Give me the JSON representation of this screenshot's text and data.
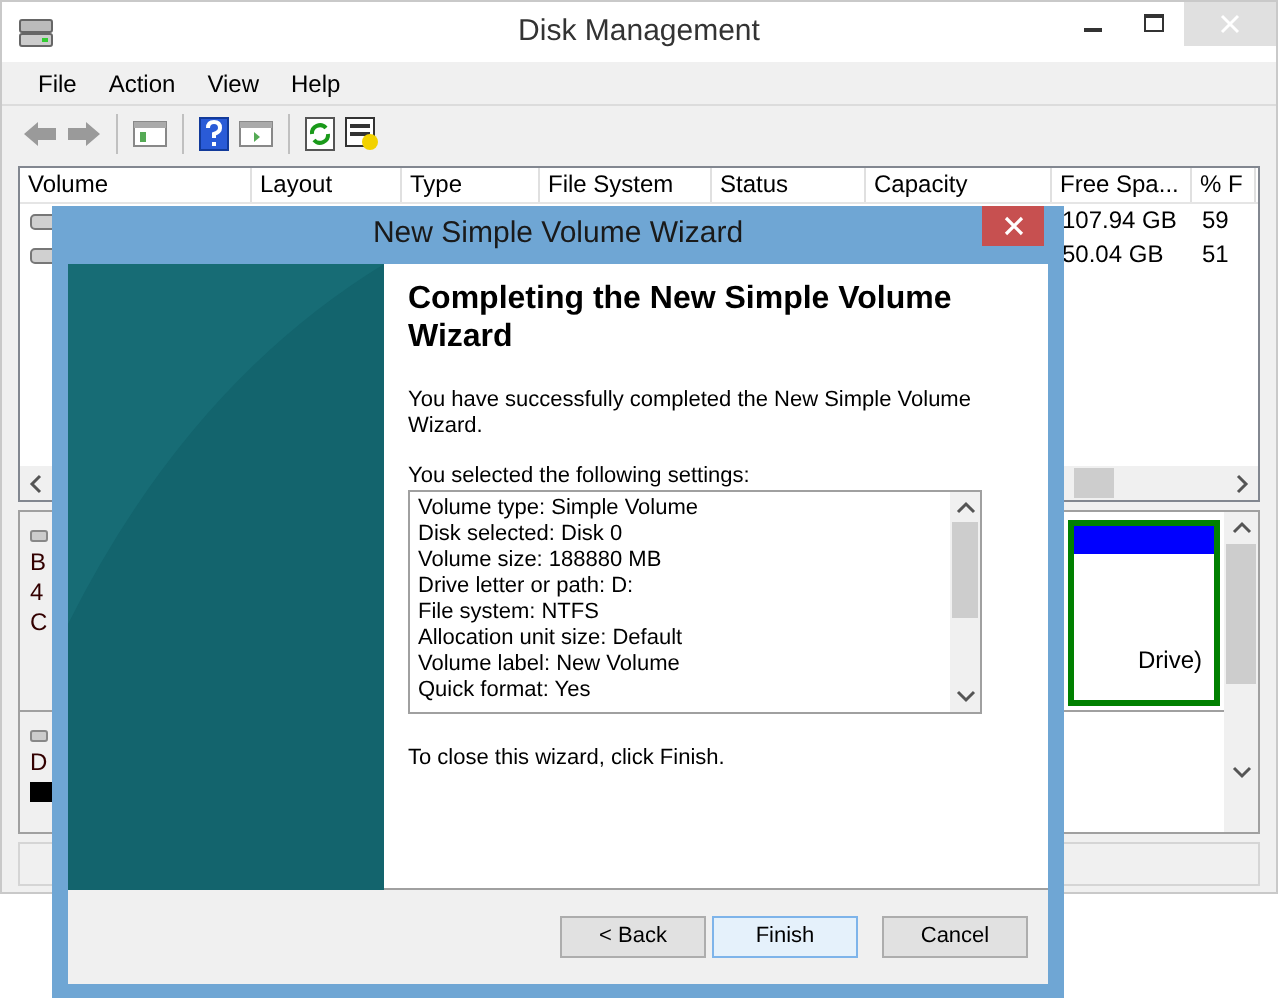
{
  "window": {
    "title": "Disk Management"
  },
  "menu": [
    "File",
    "Action",
    "View",
    "Help"
  ],
  "volume_table": {
    "columns": [
      "Volume",
      "Layout",
      "Type",
      "File System",
      "Status",
      "Capacity",
      "Free Spa...",
      "% F"
    ],
    "rows": [
      {
        "free_space": "107.94 GB",
        "column_8": "59"
      },
      {
        "free_space": "50.04 GB",
        "column_8": "51"
      }
    ]
  },
  "disk_pane": {
    "disks": [
      {
        "lines": [
          "B",
          "4",
          "C"
        ]
      },
      {
        "lines": [
          "D"
        ]
      }
    ],
    "partition": {
      "label": "Drive)"
    }
  },
  "wizard": {
    "title": "New Simple Volume Wizard",
    "heading": "Completing the New Simple Volume Wizard",
    "intro": "You have successfully completed the New Simple Volume Wizard.",
    "settings_label": "You selected the following settings:",
    "settings": [
      "Volume type: Simple Volume",
      "Disk selected: Disk 0",
      "Volume size: 188880 MB",
      "Drive letter or path: D:",
      "File system: NTFS",
      "Allocation unit size: Default",
      "Volume label: New Volume",
      "Quick format: Yes"
    ],
    "closing": "To close this wizard, click Finish.",
    "buttons": [
      {
        "label": "< Back",
        "focused": false
      },
      {
        "label": "Finish",
        "focused": true
      },
      {
        "label": "Cancel",
        "focused": false
      }
    ]
  }
}
